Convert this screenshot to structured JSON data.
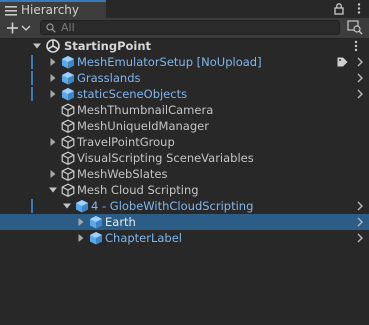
{
  "window": {
    "tab_title": "Hierarchy"
  },
  "toolbar": {
    "search_placeholder": "All"
  },
  "scene": {
    "name": "StartingPoint"
  },
  "items": [
    {
      "label": "MeshEmulatorSetup [NoUpload]",
      "icon": "prefab-cube-icon",
      "color": "#7fb7f0",
      "expandable": true,
      "expanded": false,
      "depth": 1,
      "modified": true,
      "tag": "tag-icon",
      "chevron": true
    },
    {
      "label": "Grasslands",
      "icon": "prefab-cube-icon",
      "color": "#7fb7f0",
      "expandable": true,
      "expanded": false,
      "depth": 1,
      "modified": true,
      "chevron": true
    },
    {
      "label": "staticSceneObjects",
      "icon": "prefab-cube-icon",
      "color": "#7fb7f0",
      "expandable": true,
      "expanded": false,
      "depth": 1,
      "modified": true,
      "chevron": true
    },
    {
      "label": "MeshThumbnailCamera",
      "icon": "gameobject-cube-icon",
      "color": "#c4c4c4",
      "expandable": false,
      "depth": 1
    },
    {
      "label": "MeshUniqueIdManager",
      "icon": "gameobject-cube-icon",
      "color": "#c4c4c4",
      "expandable": false,
      "depth": 1
    },
    {
      "label": "TravelPointGroup",
      "icon": "gameobject-cube-icon",
      "color": "#c4c4c4",
      "expandable": true,
      "expanded": false,
      "depth": 1
    },
    {
      "label": "VisualScripting SceneVariables",
      "icon": "gameobject-cube-icon",
      "color": "#c4c4c4",
      "expandable": false,
      "depth": 1
    },
    {
      "label": "MeshWebSlates",
      "icon": "gameobject-cube-icon",
      "color": "#c4c4c4",
      "expandable": true,
      "expanded": false,
      "depth": 1
    },
    {
      "label": "Mesh Cloud Scripting",
      "icon": "gameobject-cube-icon",
      "color": "#c4c4c4",
      "expandable": true,
      "expanded": true,
      "depth": 1
    },
    {
      "label": "4 - GlobeWithCloudScripting",
      "icon": "prefab-cube-icon",
      "color": "#7fb7f0",
      "expandable": true,
      "expanded": true,
      "depth": 2,
      "modified": true,
      "chevron": true
    },
    {
      "label": "Earth",
      "icon": "prefab-cube-icon",
      "color": "#e8e8e8",
      "expandable": true,
      "expanded": false,
      "depth": 3,
      "selected": true,
      "chevron": true
    },
    {
      "label": "ChapterLabel",
      "icon": "prefab-cube-icon",
      "color": "#7fb7f0",
      "expandable": true,
      "expanded": false,
      "depth": 3,
      "chevron": true
    }
  ]
}
